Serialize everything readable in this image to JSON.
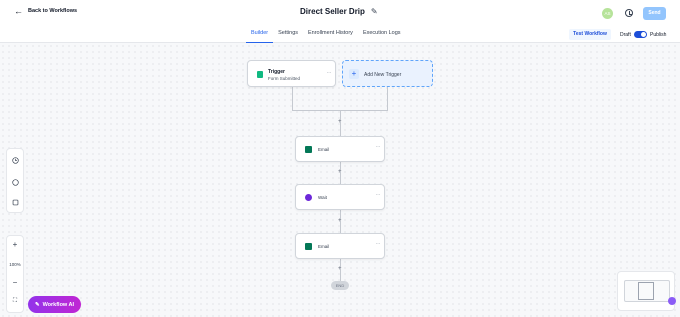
{
  "header": {
    "back_label": "Back to Workflows",
    "title": "Direct Seller Drip",
    "avatar_initials": "AS",
    "send_label": "Send"
  },
  "tabs": [
    {
      "label": "Builder",
      "active": true
    },
    {
      "label": "Settings",
      "active": false
    },
    {
      "label": "Enrollment History",
      "active": false
    },
    {
      "label": "Execution Logs",
      "active": false
    }
  ],
  "controls": {
    "test_label": "Test Workflow",
    "draft_label": "Draft",
    "publish_label": "Publish",
    "publish_on": true
  },
  "trigger": {
    "title": "Trigger",
    "subtitle": "Form Submitted",
    "add_label": "Add New Trigger"
  },
  "steps": [
    {
      "label": "Email",
      "icon": "email-icon"
    },
    {
      "label": "Wait",
      "icon": "clock-icon"
    },
    {
      "label": "Email",
      "icon": "email-icon"
    }
  ],
  "end_label": "END",
  "zoom": {
    "level": "100%"
  },
  "ai_button": "Workflow AI",
  "colors": {
    "accent": "#2563eb",
    "email": "#047857",
    "wait": "#6d28d9",
    "ai": "#9333ea"
  }
}
